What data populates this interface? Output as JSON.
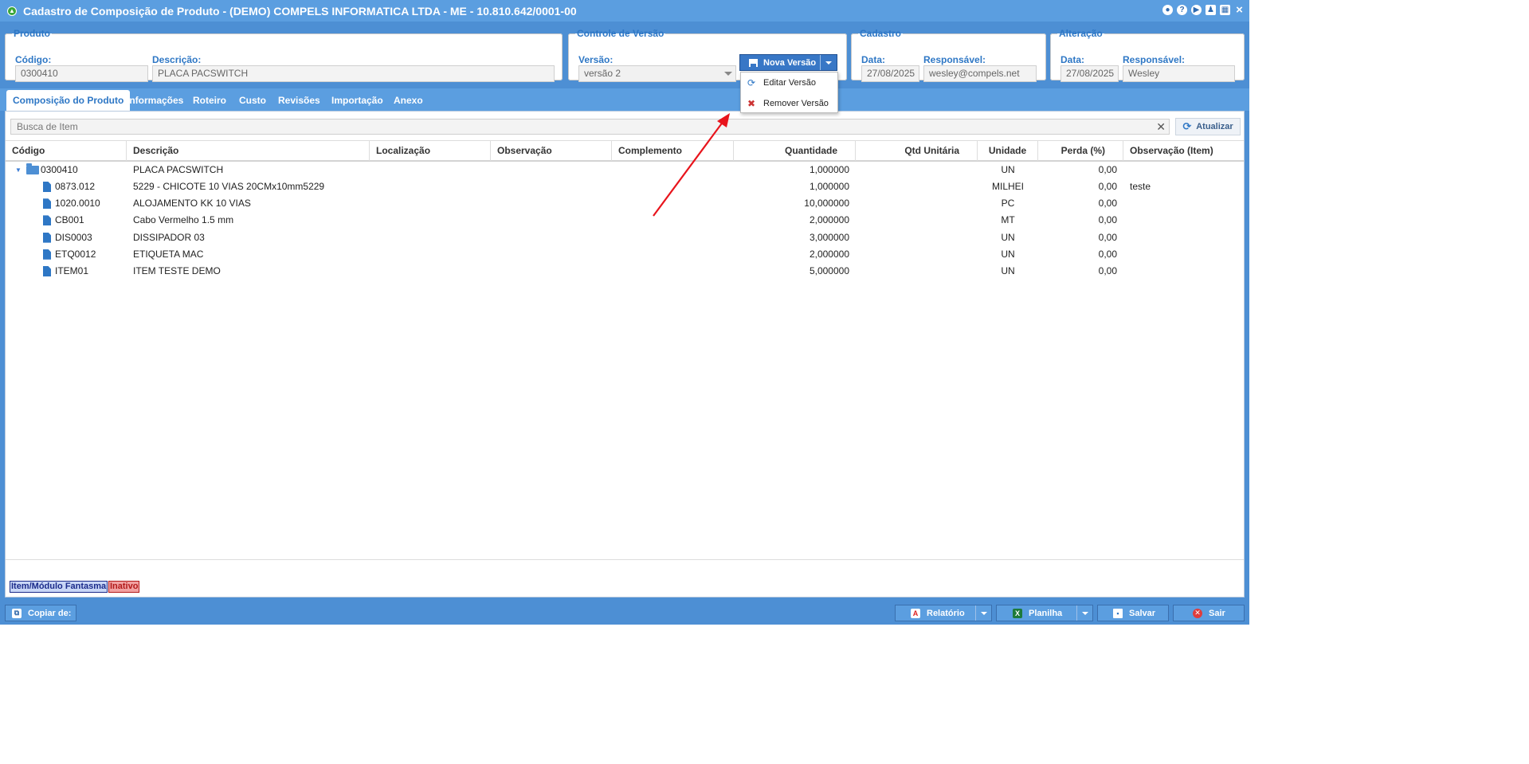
{
  "window": {
    "title": "Cadastro de Composição de Produto - (DEMO) COMPELS INFORMATICA LTDA - ME - 10.810.642/0001-00",
    "close_icon": "×"
  },
  "produto": {
    "legend": "Produto",
    "codigo_label": "Código:",
    "codigo_value": "0300410",
    "descricao_label": "Descrição:",
    "descricao_value": "PLACA PACSWITCH"
  },
  "versao": {
    "legend": "Controle de Versão",
    "versao_label": "Versão:",
    "versao_value": "versão 2",
    "nova_versao_label": "Nova Versão",
    "menu": [
      "Editar Versão",
      "Remover Versão"
    ]
  },
  "cadastro": {
    "legend": "Cadastro",
    "data_label": "Data:",
    "data_value": "27/08/2025",
    "resp_label": "Responsável:",
    "resp_value": "wesley@compels.net"
  },
  "alteracao": {
    "legend": "Alteração",
    "data_label": "Data:",
    "data_value": "27/08/2025",
    "resp_label": "Responsável:",
    "resp_value": "Wesley"
  },
  "tabs": [
    "Composição do Produto",
    "Informações",
    "Roteiro",
    "Custo",
    "Revisões",
    "Importação",
    "Anexo"
  ],
  "search": {
    "placeholder": "Busca de Item",
    "atualizar_label": "Atualizar"
  },
  "grid": {
    "columns": [
      "Código",
      "Descrição",
      "Localização",
      "Observação",
      "Complemento",
      "Quantidade",
      "Qtd Unitária",
      "Unidade",
      "Perda (%)",
      "Observação (Item)"
    ],
    "root": {
      "codigo": "0300410",
      "descricao": "PLACA PACSWITCH",
      "quantidade": "1,000000",
      "unidade": "UN",
      "perda": "0,00",
      "obs_item": ""
    },
    "rows": [
      {
        "codigo": "0873.012",
        "descricao": "5229 - CHICOTE 10 VIAS 20CMx10mm5229",
        "quantidade": "1,000000",
        "unidade": "MILHEI",
        "perda": "0,00",
        "obs_item": "teste"
      },
      {
        "codigo": "1020.0010",
        "descricao": "ALOJAMENTO KK 10 VIAS",
        "quantidade": "10,000000",
        "unidade": "PC",
        "perda": "0,00",
        "obs_item": ""
      },
      {
        "codigo": "CB001",
        "descricao": "Cabo Vermelho 1.5 mm",
        "quantidade": "2,000000",
        "unidade": "MT",
        "perda": "0,00",
        "obs_item": ""
      },
      {
        "codigo": "DIS0003",
        "descricao": "DISSIPADOR 03",
        "quantidade": "3,000000",
        "unidade": "UN",
        "perda": "0,00",
        "obs_item": ""
      },
      {
        "codigo": "ETQ0012",
        "descricao": "ETIQUETA MAC",
        "quantidade": "2,000000",
        "unidade": "UN",
        "perda": "0,00",
        "obs_item": ""
      },
      {
        "codigo": "ITEM01",
        "descricao": "ITEM TESTE DEMO",
        "quantidade": "5,000000",
        "unidade": "UN",
        "perda": "0,00",
        "obs_item": ""
      }
    ]
  },
  "legend_badges": {
    "fantasma": "Item/Módulo Fantasma",
    "inativo": "Inativo"
  },
  "footer": {
    "copiar": "Copiar de:",
    "relatorio": "Relatório",
    "planilha": "Planilha",
    "salvar": "Salvar",
    "sair": "Sair"
  },
  "colors": {
    "header_blue": "#5b9ee0",
    "accent": "#2e77c5",
    "annotation_arrow": "#e8141c"
  }
}
